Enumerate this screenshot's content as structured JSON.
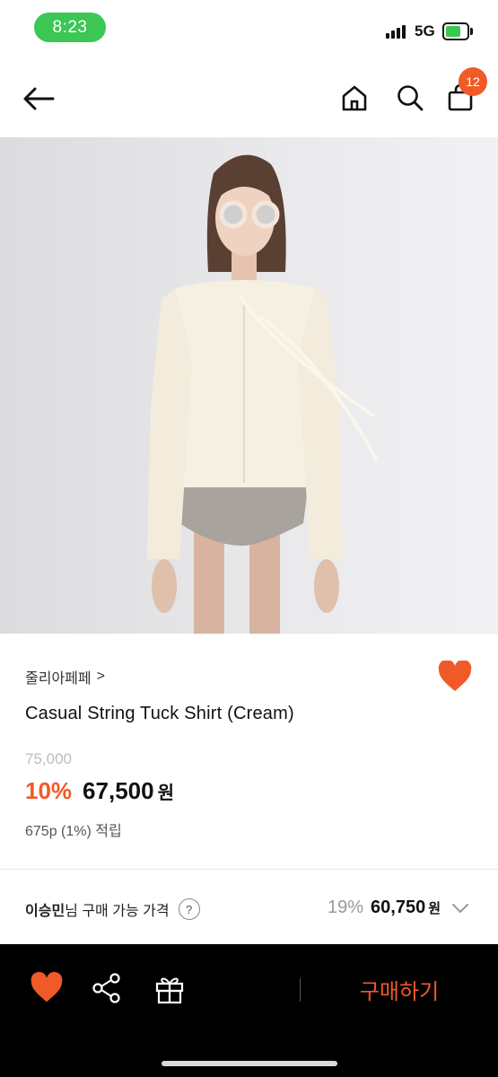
{
  "status_bar": {
    "time": "8:23",
    "network": "5G",
    "battery_icon": "battery-charging-icon",
    "signal_icon": "signal-bars-icon"
  },
  "nav": {
    "back_icon": "arrow-left-icon",
    "home_icon": "home-icon",
    "search_icon": "search-icon",
    "cart_icon": "shopping-bag-icon",
    "cart_count": "12"
  },
  "product": {
    "brand": "줄리아페페",
    "brand_chevron": ">",
    "title": "Casual String Tuck Shirt (Cream)",
    "original_price": "75,000",
    "discount": "10%",
    "sale_price": "67,500",
    "currency": "원",
    "points": "675p (1%) 적립",
    "wishlisted": true
  },
  "member_price": {
    "name": "이승민",
    "label_suffix": "님 구매 가능 가격",
    "help": "?",
    "discount": "19%",
    "amount": "60,750",
    "currency": "원"
  },
  "bottom_bar": {
    "wish_icon": "heart-icon",
    "share_icon": "share-icon",
    "gift_icon": "gift-icon",
    "buy_label": "구매하기"
  },
  "colors": {
    "accent": "#f05a28",
    "status_green": "#3cc654",
    "bottom_bar_bg": "#000000"
  }
}
